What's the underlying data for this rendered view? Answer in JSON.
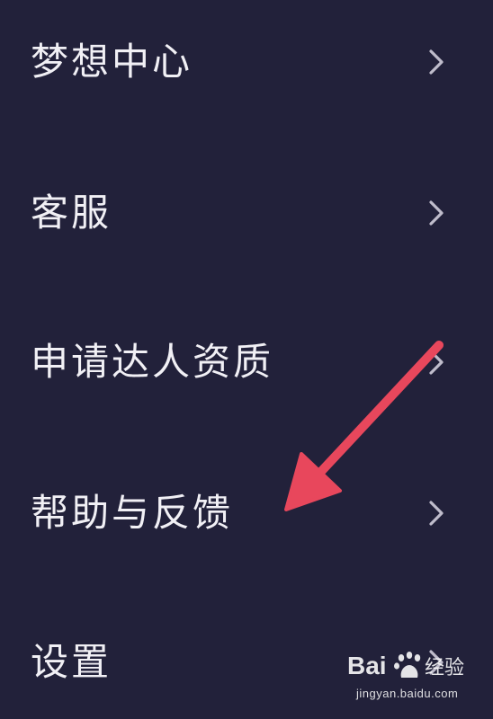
{
  "menu": {
    "items": [
      {
        "label": "梦想中心"
      },
      {
        "label": "客服"
      },
      {
        "label": "申请达人资质"
      },
      {
        "label": "帮助与反馈"
      },
      {
        "label": "设置"
      }
    ]
  },
  "icons": {
    "chevron": "chevron-right-icon",
    "annotation": "red-arrow-icon"
  },
  "colors": {
    "background": "#22213a",
    "text": "#f1f0f5",
    "chevron": "#bfbccb",
    "annotation_arrow": "#e8475c"
  },
  "watermark": {
    "logo": "Bai du 经验",
    "url": "jingyan.baidu.com"
  }
}
